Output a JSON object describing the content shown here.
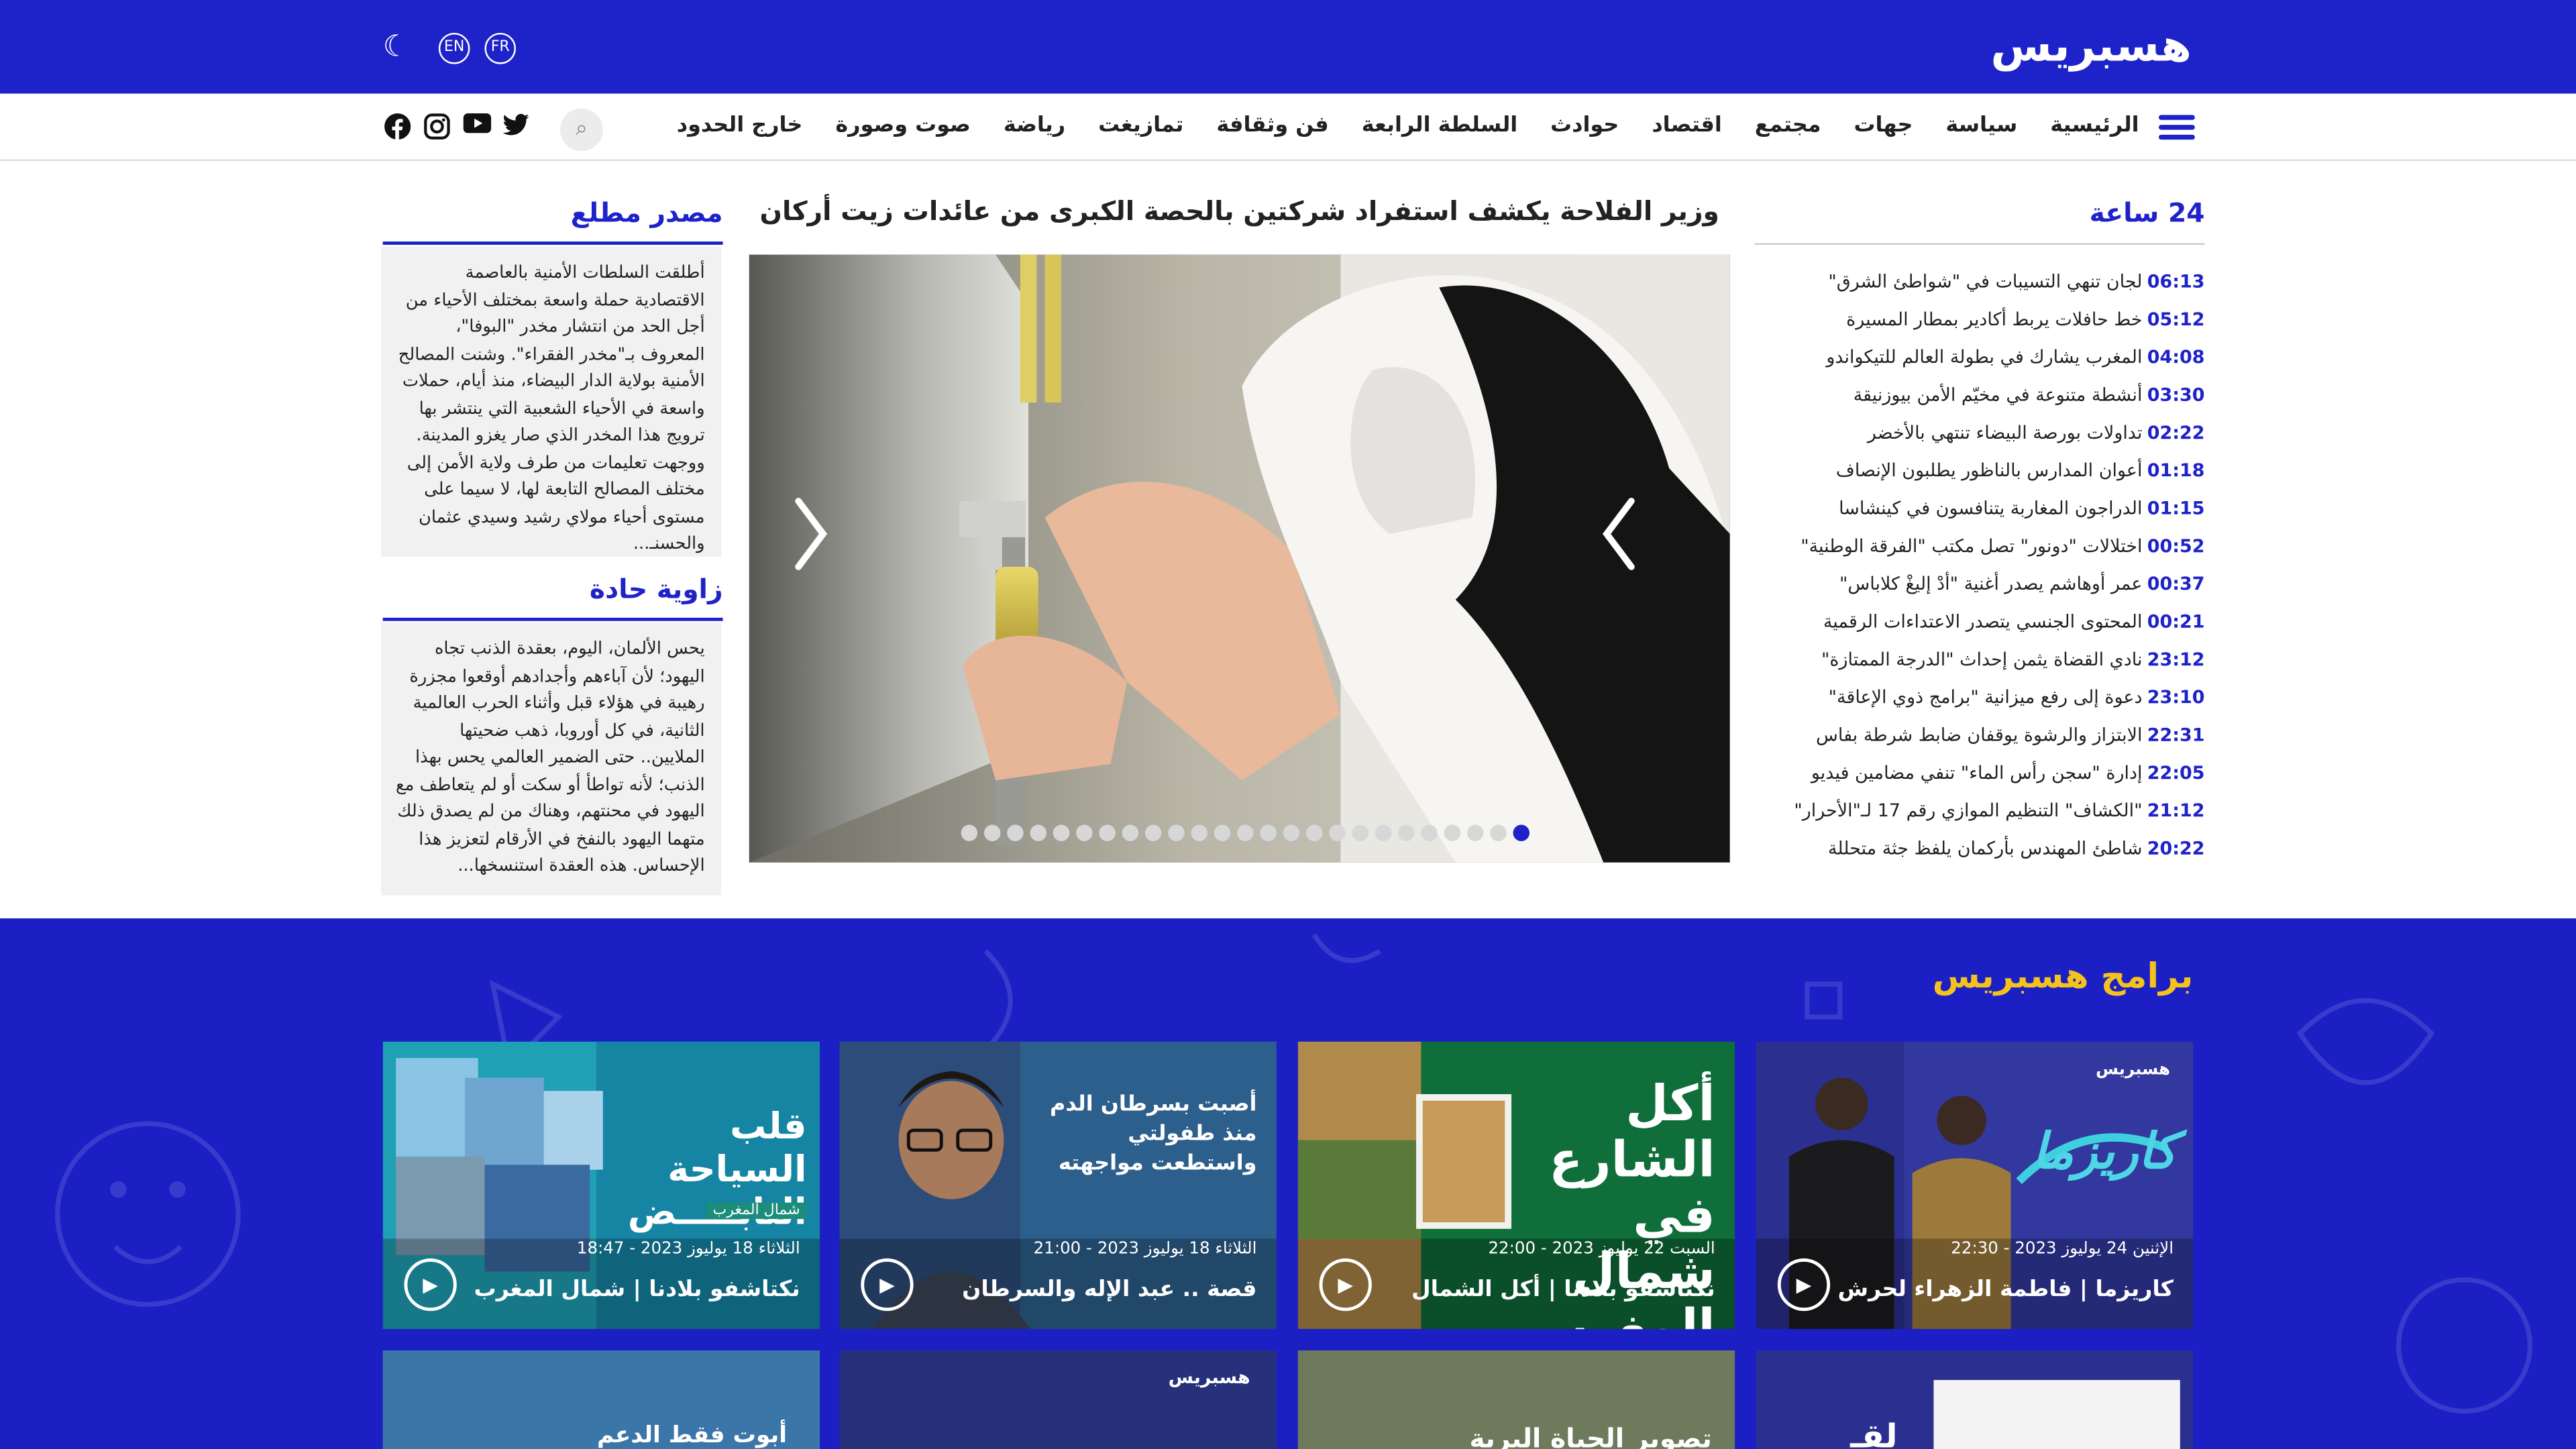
{
  "header": {
    "logo_text": "هسبريس",
    "lang_en": "EN",
    "lang_fr": "FR",
    "theme_icon": "moon-icon",
    "bg_color": "#1e22c9"
  },
  "nav": {
    "items": [
      "الرئيسية",
      "سياسة",
      "جهات",
      "مجتمع",
      "اقتصاد",
      "حوادث",
      "السلطة الرابعة",
      "فن وثقافة",
      "تمازيغت",
      "رياضة",
      "صوت وصورة",
      "خارج الحدود"
    ],
    "search_icon": "search-icon",
    "social_icons": [
      "facebook-icon",
      "instagram-icon",
      "youtube-icon",
      "twitter-icon"
    ]
  },
  "left_column": {
    "source_title": "مصدر مطلع",
    "source_text": "أطلقت السلطات الأمنية بالعاصمة الاقتصادية حملة واسعة بمختلف الأحياء من أجل الحد من انتشار مخدر \"البوفا\"، المعروف بـ\"مخدر الفقراء\". وشنت المصالح الأمنية بولاية الدار البيضاء، منذ أيام، حملات واسعة في الأحياء الشعبية التي ينتشر بها ترويج هذا المخدر الذي صار يغزو المدينة. ووجهت تعليمات من طرف ولاية الأمن إلى مختلف المصالح التابعة لها، لا سيما على مستوى أحياء مولاي رشيد وسيدي عثمان والحسنـ...",
    "angle_title": "زاوية حادة",
    "angle_text": "يحس الألمان، اليوم، بعقدة الذنب تجاه اليهود؛ لأن آباءهم وأجدادهم أوقعوا مجزرة رهيبة في هؤلاء قبل وأثناء الحرب العالمية الثانية، في كل أوروبا، ذهب ضحيتها الملايين.. حتى الضمير العالمي يحس بهذا الذنب؛ لأنه تواطأ أو سكت أو لم يتعاطف مع اليهود في محنتهم، وهناك من لم يصدق ذلك متهما اليهود بالنفخ في الأرقام لتعزيز هذا الإحساس. هذه العقدة استنسخها..."
  },
  "main_story": {
    "headline": "وزير الفلاحة يكشف استفراد شركتين بالحصة الكبرى من عائدات زيت أركان",
    "slide_count": 25,
    "active_slide": 25
  },
  "news_24": {
    "title": "24 ساعة",
    "items": [
      {
        "time": "06:13",
        "text": "لجان تنهي التسيبات في \"شواطئ الشرق\""
      },
      {
        "time": "05:12",
        "text": "خط حافلات يربط أكادير بمطار المسيرة"
      },
      {
        "time": "04:08",
        "text": "المغرب يشارك في بطولة العالم للتيكواندو"
      },
      {
        "time": "03:30",
        "text": "أنشطة متنوعة في مخيّم الأمن بيوزنيقة"
      },
      {
        "time": "02:22",
        "text": "تداولات بورصة البيضاء تنتهي بالأخضر"
      },
      {
        "time": "01:18",
        "text": "أعوان المدارس بالناظور يطلبون الإنصاف"
      },
      {
        "time": "01:15",
        "text": "الدراجون المغاربة يتنافسون في كينشاسا"
      },
      {
        "time": "00:52",
        "text": "اختلالات \"دونور\" تصل مكتب \"الفرقة الوطنية\""
      },
      {
        "time": "00:37",
        "text": "عمر أوهاشم يصدر أغنية \"أدْ إليغْ كلاباس\""
      },
      {
        "time": "00:21",
        "text": "المحتوى الجنسي يتصدر الاعتداءات الرقمية"
      },
      {
        "time": "23:12",
        "text": "نادي القضاة يثمن إحداث \"الدرجة الممتازة\""
      },
      {
        "time": "23:10",
        "text": "دعوة إلى رفع ميزانية \"برامج ذوي الإعاقة\""
      },
      {
        "time": "22:31",
        "text": "الابتزاز والرشوة يوقفان ضابط شرطة بفاس"
      },
      {
        "time": "22:05",
        "text": "إدارة \"سجن رأس الماء\" تنفي مضامين فيديو"
      },
      {
        "time": "21:12",
        "text": "\"الكشاف\" التنظيم الموازي رقم 17 لـ\"الأحرار\""
      },
      {
        "time": "20:22",
        "text": "شاطئ المهندس بأركمان يلفظ جثة متحللة"
      }
    ]
  },
  "programs": {
    "title": "برامج هسبريس",
    "title_color": "#f3c21e",
    "cards": [
      {
        "date": "الإثنين 24 يوليوز 2023 - 22:30",
        "title": "كاريزما | فاطمة الزهراء لحرش",
        "overlay": "كاريزما",
        "badge": "هسبريس"
      },
      {
        "date": "السبت 22 يوليوز 2023 - 22:00",
        "title": "نكتاشفو بلادنا | أكل الشمال",
        "overlay": "أكل الشارع في شمال المغرب"
      },
      {
        "date": "الثلاثاء 18 يوليوز 2023 - 21:00",
        "title": "قصة .. عبد الإله والسرطان",
        "overlay": "أصبت بسرطان الدم منذ طفولتي واستطعت مواجهته"
      },
      {
        "date": "الثلاثاء 18 يوليوز 2023 - 18:47",
        "title": "نكتاشفو بلادنا | شمال المغرب",
        "overlay": "قلب السياحة النابـــــض",
        "tag": "شمال المغرب"
      }
    ],
    "row2": [
      {
        "overlay": "لقـ"
      },
      {
        "overlay": "تصوير الحياة البرية"
      },
      {
        "overlay": "",
        "badge": "هسبريس"
      },
      {
        "overlay": "أبوت فقط الدعم"
      }
    ]
  }
}
